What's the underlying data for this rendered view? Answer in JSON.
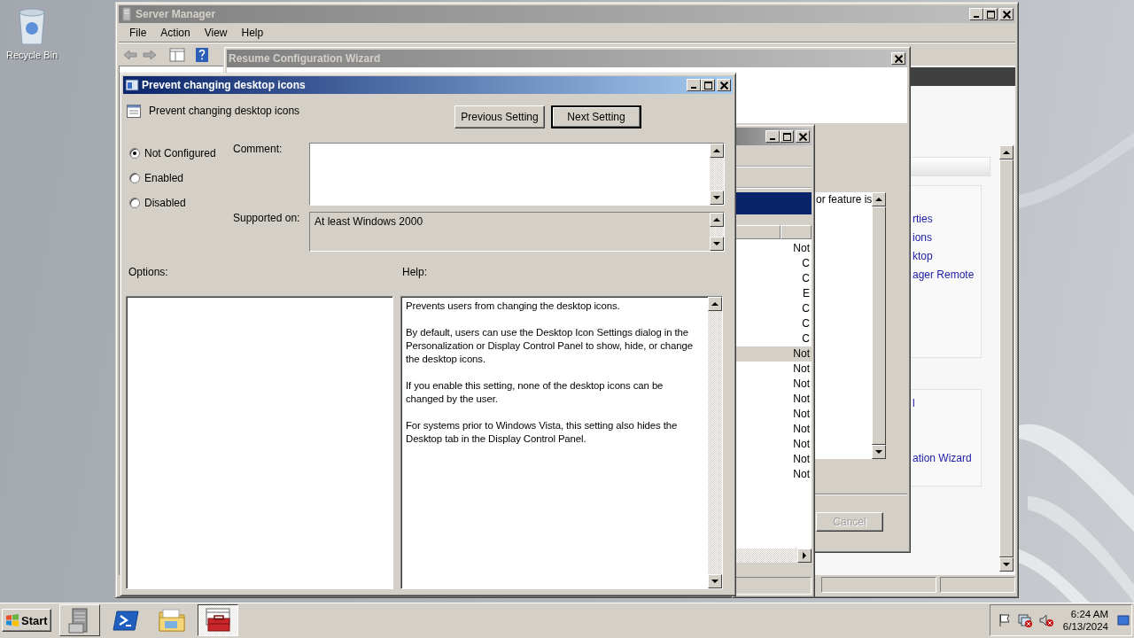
{
  "desktop": {
    "icons": [
      {
        "label": "Recycle Bin"
      }
    ]
  },
  "server_manager": {
    "title": "Server Manager",
    "active": false,
    "menu": [
      "File",
      "Action",
      "View",
      "Help"
    ],
    "link_groups": [
      {
        "links": [
          "rties",
          "ions",
          "ktop",
          "ager Remote"
        ]
      },
      {
        "links": [
          "l",
          "ation Wizard"
        ]
      }
    ]
  },
  "wizard": {
    "title": "Resume Configuration Wizard",
    "active": false,
    "text": "or feature is",
    "cancel": {
      "label": "Cancel",
      "disabled": true
    }
  },
  "policy_editor": {
    "active": false,
    "rows": [
      {
        "state": "Not",
        "selected": false
      },
      {
        "state": "C",
        "selected": false
      },
      {
        "state": "C",
        "selected": false
      },
      {
        "state": "E",
        "selected": false
      },
      {
        "state": "C",
        "selected": false
      },
      {
        "state": "C",
        "selected": false
      },
      {
        "state": "C",
        "selected": false
      },
      {
        "state": "Not",
        "selected": true
      },
      {
        "state": "Not",
        "selected": false
      },
      {
        "state": "Not",
        "selected": false
      },
      {
        "state": "Not",
        "selected": false
      },
      {
        "state": "Not",
        "selected": false
      },
      {
        "state": "Not",
        "selected": false
      },
      {
        "state": "Not",
        "selected": false
      },
      {
        "state": "Not",
        "selected": false
      },
      {
        "state": "Not",
        "selected": false
      }
    ]
  },
  "dialog": {
    "title": "Prevent changing desktop icons",
    "active": true,
    "setting_name": "Prevent changing desktop icons",
    "buttons": [
      {
        "label": "Previous Setting",
        "focused": false
      },
      {
        "label": "Next Setting",
        "focused": true
      }
    ],
    "radios": [
      {
        "label": "Not Configured",
        "selected": true
      },
      {
        "label": "Enabled",
        "selected": false
      },
      {
        "label": "Disabled",
        "selected": false
      }
    ],
    "comment_label": "Comment:",
    "supported_label": "Supported on:",
    "supported_value": "At least Windows 2000",
    "options_label": "Options:",
    "help_label": "Help:",
    "help": [
      "Prevents users from changing the desktop icons.",
      "By default, users can use the Desktop Icon Settings dialog in the Personalization or Display Control Panel to show, hide, or change the desktop icons.",
      "If you enable this setting, none of the desktop icons can be changed by the user.",
      "For systems prior to Windows Vista, this setting also hides the Desktop tab in the Display Control Panel."
    ]
  },
  "taskbar": {
    "start": "Start",
    "apps": [
      {
        "kind": "server",
        "active": false
      },
      {
        "kind": "powershell",
        "active": false
      },
      {
        "kind": "folder",
        "active": false
      },
      {
        "kind": "toolbox",
        "active": true
      }
    ],
    "clock": {
      "time": "6:24 AM",
      "date": "6/13/2024"
    }
  }
}
